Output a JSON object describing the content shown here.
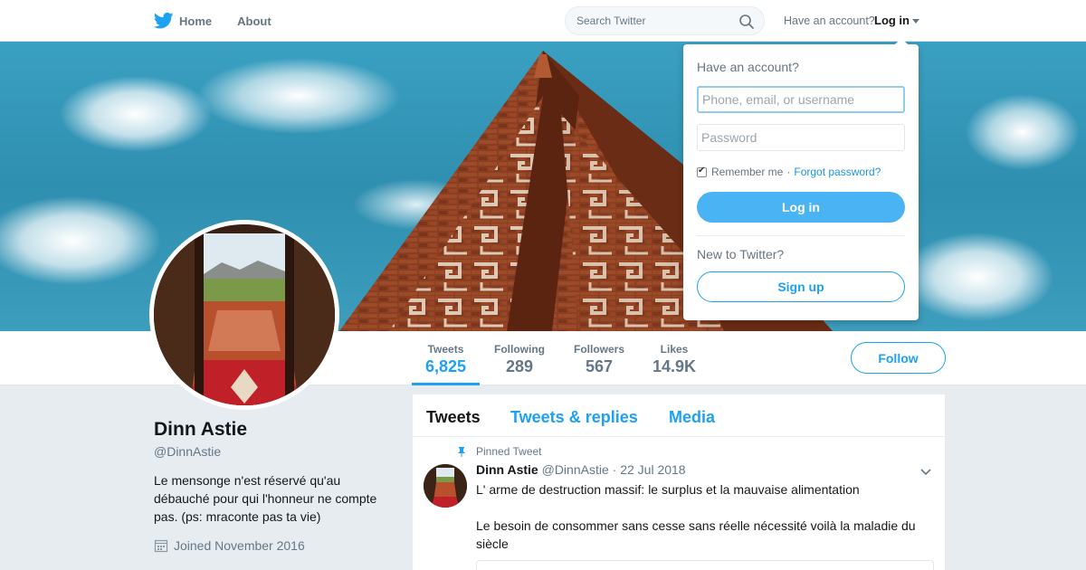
{
  "nav": {
    "home_label": "Home",
    "about_label": "About",
    "search_placeholder": "Search Twitter",
    "have_account": "Have an account?",
    "login_label": "Log in"
  },
  "profile": {
    "name": "Dinn Astie",
    "handle": "@DinnAstie",
    "bio": "Le mensonge n'est réservé qu'au débauché pour qui l'honneur ne compte pas. (ps: mraconte pas ta vie)",
    "joined": "Joined November 2016"
  },
  "stats": [
    {
      "label": "Tweets",
      "value": "6,825",
      "active": true
    },
    {
      "label": "Following",
      "value": "289"
    },
    {
      "label": "Followers",
      "value": "567"
    },
    {
      "label": "Likes",
      "value": "14.9K"
    }
  ],
  "follow_label": "Follow",
  "timeline": {
    "tabs": [
      "Tweets",
      "Tweets & replies",
      "Media"
    ],
    "pinned_label": "Pinned Tweet",
    "tweet": {
      "name": "Dinn Astie",
      "handle": "@DinnAstie",
      "separator": "·",
      "date": "22 Jul 2018",
      "line1": "L' arme de destruction massif: le surplus et la mauvaise alimentation",
      "line2": "Le besoin de consommer sans cesse sans réelle nécessité voilà la maladie du siècle"
    }
  },
  "login_dropdown": {
    "title": "Have an account?",
    "username_placeholder": "Phone, email, or username",
    "password_placeholder": "Password",
    "remember_label": "Remember me",
    "separator": "·",
    "forgot_label": "Forgot password?",
    "login_button": "Log in",
    "new_label": "New to Twitter?",
    "signup_button": "Sign up"
  },
  "colors": {
    "accent": "#1da1f2",
    "login_button": "#4ab3f4",
    "background": "#e6ecf0"
  },
  "icons": [
    "twitter-bird-icon",
    "search-icon",
    "caret-down-icon",
    "calendar-icon",
    "pin-icon",
    "chevron-down-icon"
  ]
}
